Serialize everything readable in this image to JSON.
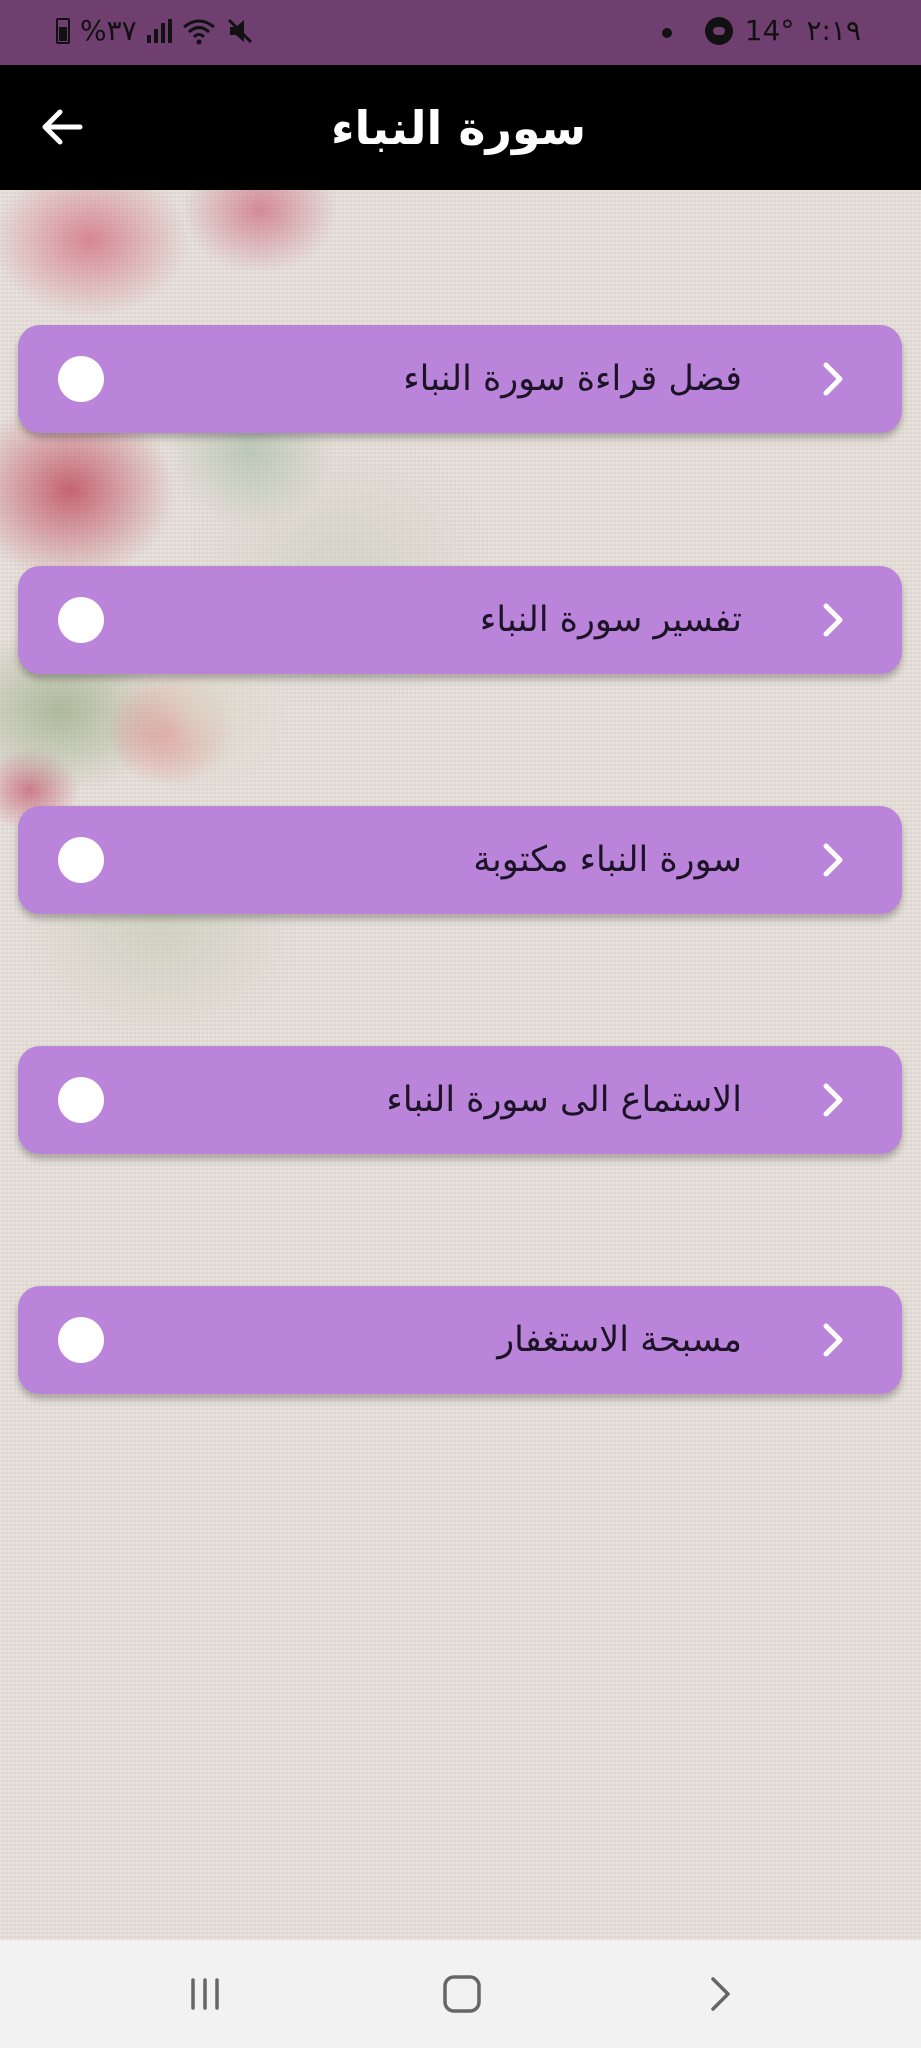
{
  "status_bar": {
    "left_text": "%٣٧",
    "temperature": "14°",
    "time": "٢:١٩"
  },
  "app_bar": {
    "title": "سورة النباء"
  },
  "menu": {
    "items": [
      {
        "label": "فضل قراءة سورة النباء"
      },
      {
        "label": "تفسير سورة النباء"
      },
      {
        "label": "سورة النباء مكتوبة"
      },
      {
        "label": "الاستماع الى سورة النباء"
      },
      {
        "label": "مسبحة الاستغفار"
      }
    ]
  },
  "colors": {
    "status_bar": "#6e3f6f",
    "app_bar": "#000000",
    "menu_item": "#b984d9",
    "nav_bar": "#f2f2f2"
  },
  "icons": {
    "back": "arrow-left-icon",
    "item_chevron": "chevron-right-icon",
    "nav_recents": "recents-icon",
    "nav_home": "home-icon",
    "nav_back": "nav-back-chevron-icon"
  }
}
